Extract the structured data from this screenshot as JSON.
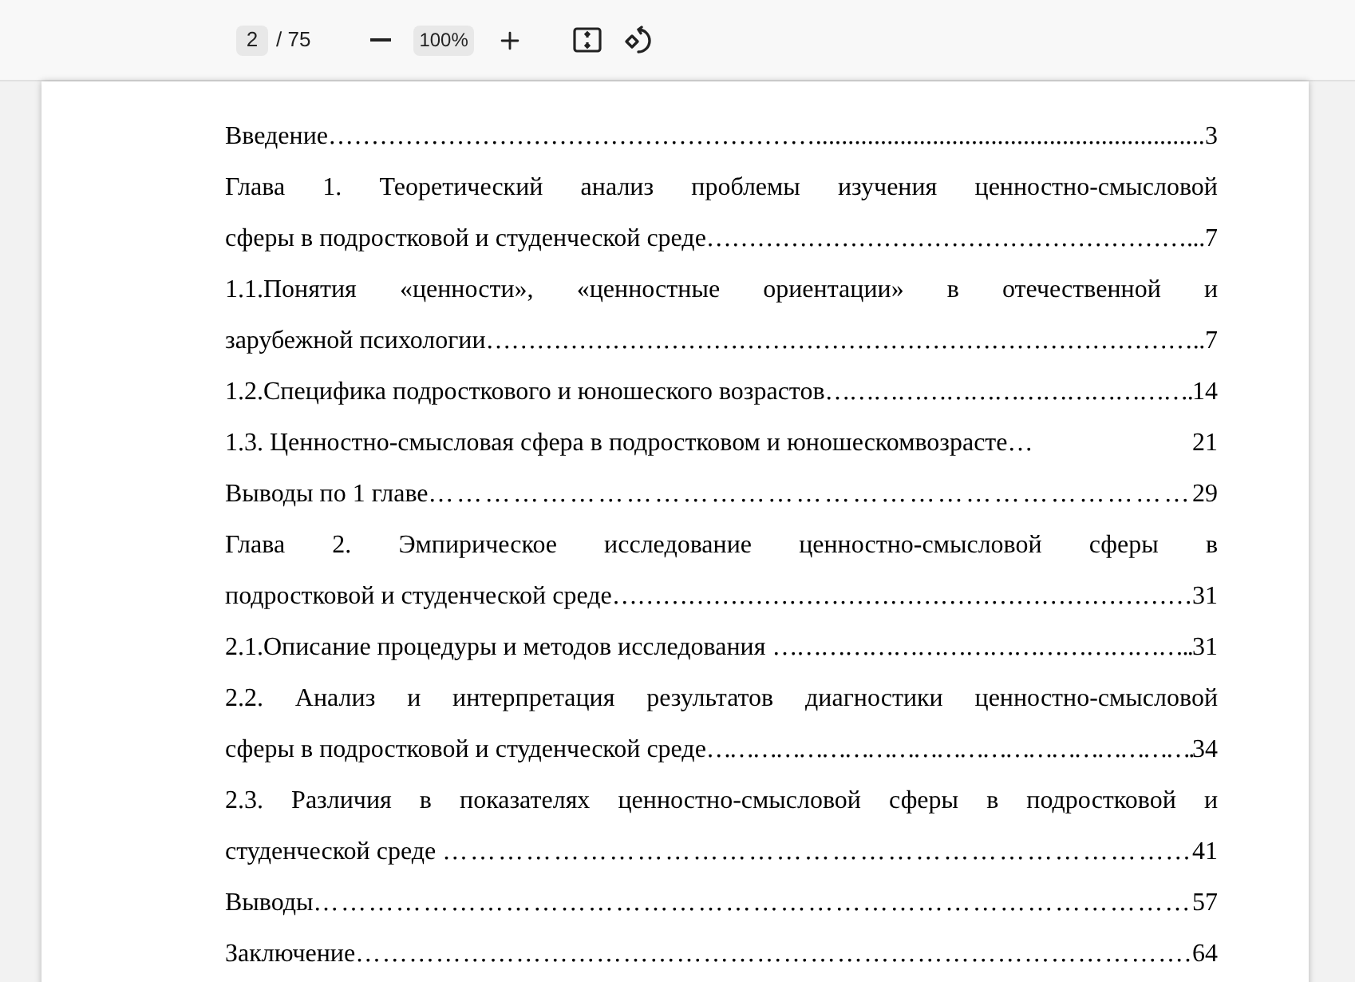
{
  "toolbar": {
    "page_input": {
      "value": "2"
    },
    "page_total": "/ 75",
    "zoom_value": "100%"
  },
  "toc": [
    {
      "last": {
        "text": "Введение",
        "leader": "…………………………………………………............................................................",
        "page": "3"
      }
    },
    {
      "lines": [
        "Глава 1. Теоретический анализ проблемы изучения ценностно-смысловой"
      ],
      "last": {
        "text": "сферы в подростковой и студенческой среде",
        "leader": "…………………………………………………...",
        "page": "7"
      }
    },
    {
      "lines": [
        "1.1.Понятия «ценности», «ценностные ориентации» в отечественной и"
      ],
      "last": {
        "text": "зарубежной психологии",
        "leader": "…………………………………………………………………………..",
        "page": "7"
      }
    },
    {
      "last": {
        "text": "1.2.Специфика подросткового и юношеского возрастов",
        "leader": "……………………………………….",
        "page": "14"
      }
    },
    {
      "last": {
        "text": "1.3. Ценностно-смысловая сфера в подростковом и юношескомвозрасте",
        "leader": "…",
        "page": "21"
      }
    },
    {
      "last": {
        "text": "Выводы по 1 главе",
        "leader": "………………………………………………………………………",
        "page": "29"
      }
    },
    {
      "lines": [
        "Глава 2. Эмпирическое исследование ценностно-смысловой сферы в"
      ],
      "last": {
        "text": "подростковой и студенческой среде",
        "leader": "……………………………………………………………",
        "page": "31"
      }
    },
    {
      "last": {
        "text": "2.1.Описание процедуры и методов исследования ",
        "leader": "……………………………………………..",
        "page": "31"
      }
    },
    {
      "lines": [
        "2.2. Анализ и интерпретация результатов диагностики ценностно-смысловой"
      ],
      "last": {
        "text": "сферы в подростковой и студенческой среде",
        "leader": "……………………………………………………….",
        "page": "34"
      }
    },
    {
      "lines": [
        "2.3. Различия в показателях ценностно-смысловой сферы в подростковой и"
      ],
      "last": {
        "text": "студенческой среде ",
        "leader": "……………………………………………………………………...",
        "page": "41"
      }
    },
    {
      "last": {
        "text": "Выводы",
        "leader": "……………………………………………………………………………………",
        "page": "57"
      }
    },
    {
      "last": {
        "text": "Заключение",
        "leader": "………………………………………………………………………………….",
        "page": "64"
      }
    }
  ]
}
